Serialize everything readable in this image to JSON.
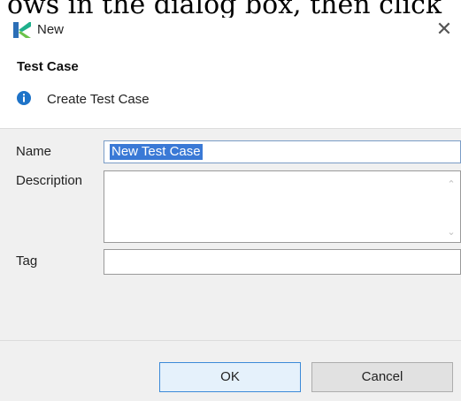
{
  "document": {
    "caption": "ows in the dialog box, then click"
  },
  "dialog": {
    "title": "New",
    "close_glyph": "✕",
    "icon": "katalon-k-logo-icon",
    "banner": {
      "title": "Test Case",
      "message": "Create Test Case",
      "icon": "info-icon"
    },
    "form": {
      "name_label": "Name",
      "name_value": "New Test Case",
      "description_label": "Description",
      "description_value": "",
      "tag_label": "Tag",
      "tag_value": ""
    },
    "buttons": {
      "ok_label": "OK",
      "cancel_label": "Cancel"
    }
  },
  "colors": {
    "selection": "#3a79d6",
    "info": "#1e73c8",
    "form_background": "#f0f0f0",
    "ok_border": "#3c8ad8"
  }
}
